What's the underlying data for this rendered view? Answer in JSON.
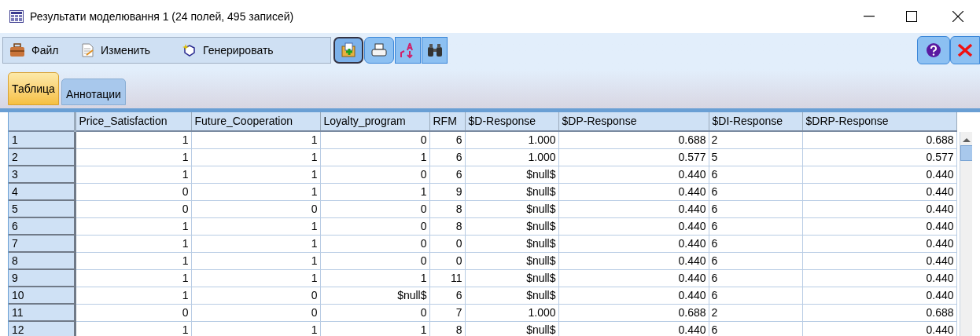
{
  "window": {
    "title": "Результати моделювання 1 (24 полей, 495 записей)"
  },
  "menu": [
    {
      "label": "Файл"
    },
    {
      "label": "Изменить"
    },
    {
      "label": "Генерировать"
    }
  ],
  "tabs": [
    {
      "label": "Таблица",
      "selected": true
    },
    {
      "label": "Аннотации",
      "selected": false
    }
  ],
  "table": {
    "columns": [
      {
        "label": "Price_Satisfaction"
      },
      {
        "label": "Future_Cooperation"
      },
      {
        "label": "Loyalty_program"
      },
      {
        "label": "RFM"
      },
      {
        "label": "$D-Response"
      },
      {
        "label": "$DP-Response"
      },
      {
        "label": "$DI-Response"
      },
      {
        "label": "$DRP-Response"
      }
    ],
    "rows": [
      {
        "index": "1",
        "cells": [
          "1",
          "1",
          "0",
          "6",
          "1.000",
          "0.688",
          "2",
          "0.688"
        ]
      },
      {
        "index": "2",
        "cells": [
          "1",
          "1",
          "1",
          "6",
          "1.000",
          "0.577",
          "5",
          "0.577"
        ]
      },
      {
        "index": "3",
        "cells": [
          "1",
          "1",
          "0",
          "6",
          "$null$",
          "0.440",
          "6",
          "0.440"
        ]
      },
      {
        "index": "4",
        "cells": [
          "0",
          "1",
          "1",
          "9",
          "$null$",
          "0.440",
          "6",
          "0.440"
        ]
      },
      {
        "index": "5",
        "cells": [
          "0",
          "0",
          "0",
          "8",
          "$null$",
          "0.440",
          "6",
          "0.440"
        ]
      },
      {
        "index": "6",
        "cells": [
          "1",
          "1",
          "0",
          "8",
          "$null$",
          "0.440",
          "6",
          "0.440"
        ]
      },
      {
        "index": "7",
        "cells": [
          "1",
          "1",
          "0",
          "0",
          "$null$",
          "0.440",
          "6",
          "0.440"
        ]
      },
      {
        "index": "8",
        "cells": [
          "1",
          "1",
          "0",
          "0",
          "$null$",
          "0.440",
          "6",
          "0.440"
        ]
      },
      {
        "index": "9",
        "cells": [
          "1",
          "1",
          "1",
          "11",
          "$null$",
          "0.440",
          "6",
          "0.440"
        ]
      },
      {
        "index": "10",
        "cells": [
          "1",
          "0",
          "$null$",
          "6",
          "$null$",
          "0.440",
          "6",
          "0.440"
        ]
      },
      {
        "index": "11",
        "cells": [
          "0",
          "0",
          "0",
          "7",
          "1.000",
          "0.688",
          "2",
          "0.688"
        ]
      },
      {
        "index": "12",
        "cells": [
          "1",
          "1",
          "1",
          "8",
          "$null$",
          "0.440",
          "6",
          "0.440"
        ]
      }
    ]
  }
}
